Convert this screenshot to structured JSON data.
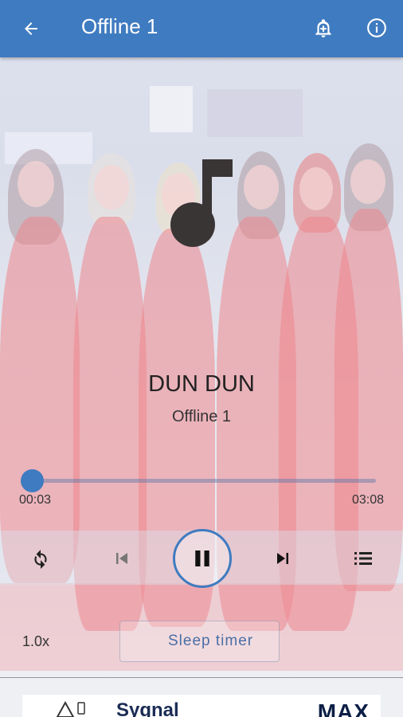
{
  "app_bar": {
    "title": "Offline 1",
    "back_icon": "arrow-left-icon",
    "alarm_icon": "bell-add-icon",
    "info_icon": "info-circle-icon",
    "color": "#3f7bc0"
  },
  "now_playing": {
    "song_title": "DUN DUN",
    "playlist": "Offline 1",
    "art_icon": "music-note-icon"
  },
  "progress": {
    "current_time": "00:03",
    "total_time": "03:08",
    "fraction": 0.016
  },
  "controls": {
    "repeat_icon": "repeat-icon",
    "previous_icon": "skip-previous-icon",
    "play_pause_icon": "pause-icon",
    "next_icon": "skip-next-icon",
    "queue_icon": "queue-list-icon"
  },
  "bottom": {
    "speed": "1.0x",
    "sleep_timer_label": "Sleep timer",
    "sleep_icon": "moon-icon"
  },
  "ad": {
    "brand_text": "Sygnal",
    "right_text": "MAX"
  }
}
